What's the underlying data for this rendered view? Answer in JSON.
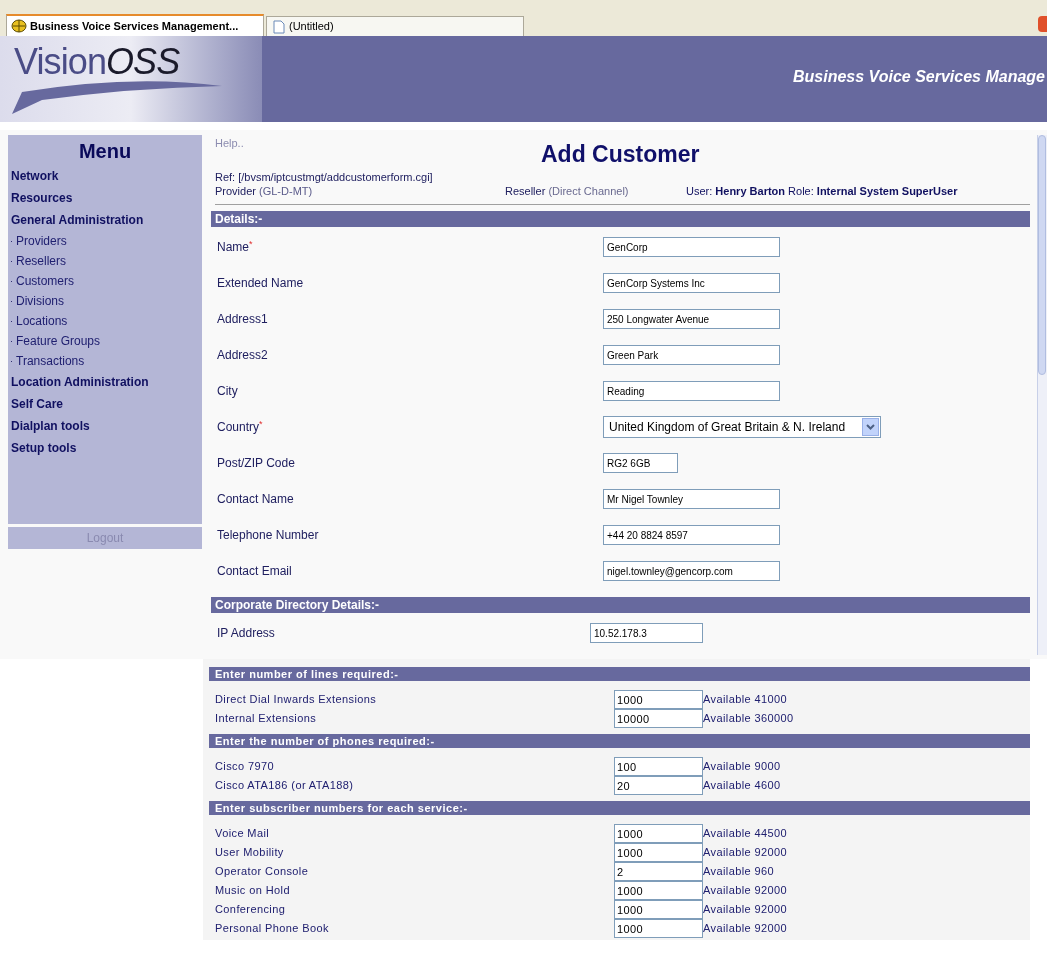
{
  "browser_tabs": [
    {
      "label": "Business Voice Services Management...",
      "selected": true
    },
    {
      "label": "(Untitled)",
      "selected": false
    }
  ],
  "header": {
    "logo_plain": "Vision",
    "logo_italic": "OSS",
    "title": "Business Voice Services Manage"
  },
  "sidebar": {
    "heading": "Menu",
    "items": [
      {
        "label": "Network",
        "kind": "section"
      },
      {
        "label": "Resources",
        "kind": "section"
      },
      {
        "label": "General Administration",
        "kind": "section"
      },
      {
        "label": "Providers",
        "kind": "sub"
      },
      {
        "label": "Resellers",
        "kind": "sub"
      },
      {
        "label": "Customers",
        "kind": "sub"
      },
      {
        "label": "Divisions",
        "kind": "sub"
      },
      {
        "label": "Locations",
        "kind": "sub"
      },
      {
        "label": "Feature Groups",
        "kind": "sub"
      },
      {
        "label": "Transactions",
        "kind": "sub"
      },
      {
        "label": "Location Administration",
        "kind": "section"
      },
      {
        "label": "Self Care",
        "kind": "section"
      },
      {
        "label": "Dialplan tools",
        "kind": "section"
      },
      {
        "label": "Setup tools",
        "kind": "section"
      }
    ],
    "logout": "Logout"
  },
  "help": "Help..",
  "page_title": "Add Customer",
  "ref": "Ref: [/bvsm/iptcustmgt/addcustomerform.cgi]",
  "provider": {
    "label": "Provider",
    "value": "(GL-D-MT)"
  },
  "reseller": {
    "label": "Reseller",
    "value": "(Direct Channel)"
  },
  "user_line": "User: **Henry Barton** Role: **Internal System SuperUser**",
  "form_sections": [
    {
      "title": "Details:-",
      "kind": "form",
      "fields": [
        {
          "label": "Name",
          "marker": "*",
          "value": "GenCorp",
          "kind": "text"
        },
        {
          "label": "Extended Name",
          "value": "GenCorp Systems Inc",
          "kind": "text"
        },
        {
          "label": "Address1",
          "value": "250 Longwater Avenue",
          "kind": "text"
        },
        {
          "label": "Address2",
          "value": "Green Park",
          "kind": "text"
        },
        {
          "label": "City",
          "value": "Reading",
          "kind": "text"
        },
        {
          "label": "Country",
          "marker": "*",
          "value": "United Kingdom of Great Britain & N. Ireland",
          "kind": "select"
        },
        {
          "label": "Post/ZIP Code",
          "value": "RG2 6GB",
          "kind": "short"
        },
        {
          "label": "Contact Name",
          "value": "Mr Nigel Townley",
          "kind": "text"
        },
        {
          "label": "Telephone Number",
          "value": "+44 20 8824 8597",
          "kind": "text"
        },
        {
          "label": "Contact Email",
          "value": "nigel.townley@gencorp.com",
          "kind": "text"
        }
      ]
    },
    {
      "title": "Corporate Directory Details:-",
      "kind": "form",
      "fields": [
        {
          "label": "IP Address",
          "value": "10.52.178.3",
          "kind": "ip"
        }
      ]
    },
    {
      "title": "Enter number of lines required:-",
      "kind": "quantity",
      "rows": [
        {
          "label": "Direct Dial Inwards Extensions",
          "value": "1000",
          "available": "Available 41000"
        },
        {
          "label": "Internal Extensions",
          "value": "10000",
          "available": "Available 360000"
        }
      ]
    },
    {
      "title": "Enter the number of phones required:-",
      "kind": "quantity",
      "rows": [
        {
          "label": "Cisco 7970",
          "value": "100",
          "available": "Available 9000"
        },
        {
          "label": "Cisco ATA186 (or ATA188)",
          "value": "20",
          "available": "Available 4600"
        }
      ]
    },
    {
      "title": "Enter subscriber numbers for each service:-",
      "kind": "quantity",
      "rows": [
        {
          "label": "Voice Mail",
          "value": "1000",
          "available": "Available 44500"
        },
        {
          "label": "User Mobility",
          "value": "1000",
          "available": "Available 92000"
        },
        {
          "label": "Operator Console",
          "value": "2",
          "available": "Available 960"
        },
        {
          "label": "Music on Hold",
          "value": "1000",
          "available": "Available 92000"
        },
        {
          "label": "Conferencing",
          "value": "1000",
          "available": "Available 92000"
        },
        {
          "label": "Personal Phone Book",
          "value": "1000",
          "available": "Available 92000"
        }
      ]
    }
  ]
}
